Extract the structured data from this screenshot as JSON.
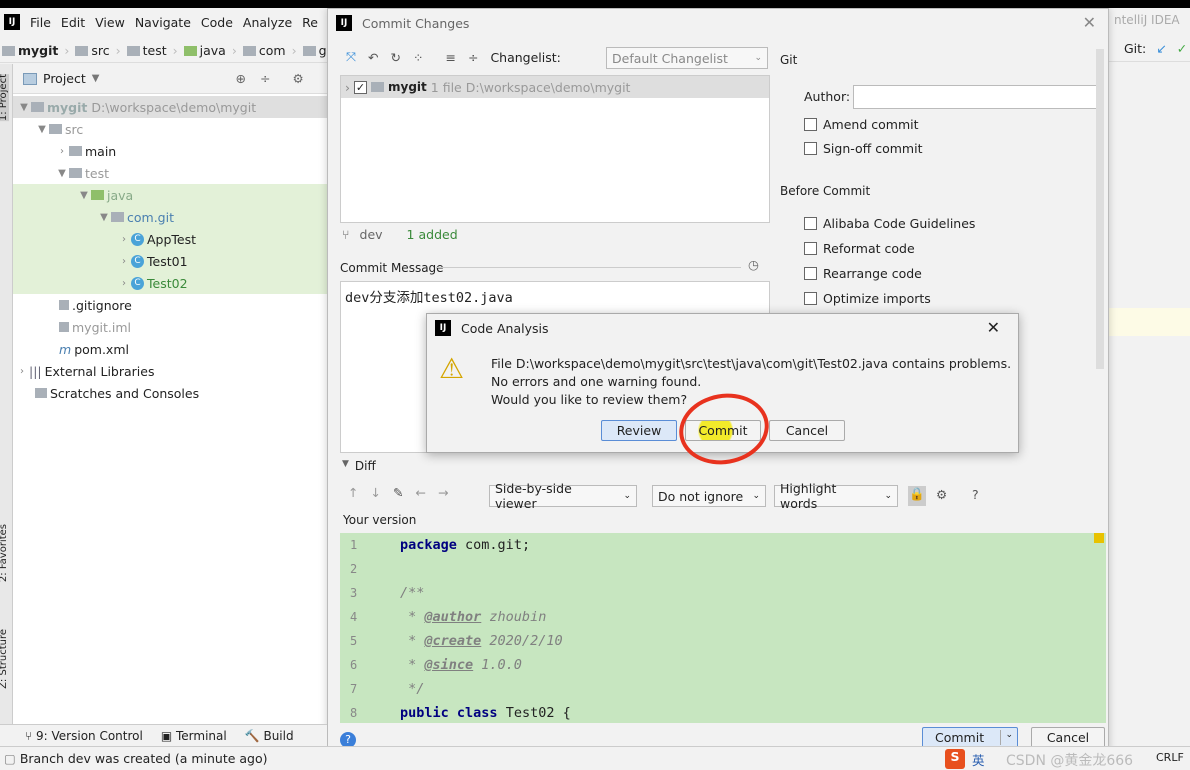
{
  "ide": {
    "menu": [
      "File",
      "Edit",
      "View",
      "Navigate",
      "Code",
      "Analyze",
      "Re"
    ],
    "breadcrumb": [
      "mygit",
      "src",
      "test",
      "java",
      "com",
      "gi"
    ],
    "project_panel_title": "Project",
    "left_strip": {
      "project": "1: Project",
      "favorites": "2: Favorites",
      "structure": "Z: Structure"
    },
    "tree": [
      {
        "label": "mygit",
        "path": "D:\\workspace\\demo\\mygit"
      },
      {
        "label": "src"
      },
      {
        "label": "main"
      },
      {
        "label": "test"
      },
      {
        "label": "java"
      },
      {
        "label": "com.git"
      },
      {
        "label": "AppTest"
      },
      {
        "label": "Test01"
      },
      {
        "label": "Test02"
      },
      {
        "label": ".gitignore"
      },
      {
        "label": "mygit.iml"
      },
      {
        "label": "pom.xml"
      },
      {
        "label": "External Libraries"
      },
      {
        "label": "Scratches and Consoles"
      }
    ],
    "right_title": "ntelliJ IDEA",
    "git_label": "Git:",
    "tool_windows": [
      "9: Version Control",
      "Terminal",
      "Build"
    ],
    "status": "Branch dev was created (a minute ago)",
    "crlf": "CRLF",
    "watermark": "CSDN @黄金龙666",
    "ime": "英"
  },
  "dialog": {
    "title": "Commit Changes",
    "changelist_label": "Changelist:",
    "changelist_value": "Default Changelist",
    "changes_row": {
      "name": "mygit",
      "count": "1 file",
      "path": "D:\\workspace\\demo\\mygit"
    },
    "branch": "dev",
    "added": "1 added",
    "commit_message_label": "Commit Message",
    "commit_message": "dev分支添加test02.java",
    "git_section": "Git",
    "author_label": "Author:",
    "author_value": "",
    "amend": "Amend commit",
    "signoff": "Sign-off commit",
    "before_commit": "Before Commit",
    "checks": [
      "Alibaba Code Guidelines",
      "Reformat code",
      "Rearrange code",
      "Optimize imports"
    ],
    "diff_label": "Diff",
    "viewer": "Side-by-side viewer",
    "ignore": "Do not ignore",
    "highlight": "Highlight words",
    "your_version": "Your version",
    "code": [
      {
        "n": "1",
        "parts": [
          [
            "kw",
            "package"
          ],
          [
            "",
            "com.git;"
          ]
        ]
      },
      {
        "n": "2",
        "parts": []
      },
      {
        "n": "3",
        "parts": [
          [
            "doc",
            "/**"
          ]
        ]
      },
      {
        "n": "4",
        "parts": [
          [
            "doc",
            " * "
          ],
          [
            "tag",
            "@author"
          ],
          [
            "doc",
            " zhoubin"
          ]
        ]
      },
      {
        "n": "5",
        "parts": [
          [
            "doc",
            " * "
          ],
          [
            "tag",
            "@create"
          ],
          [
            "doc",
            " 2020/2/10"
          ]
        ]
      },
      {
        "n": "6",
        "parts": [
          [
            "doc",
            " * "
          ],
          [
            "tag",
            "@since"
          ],
          [
            "doc",
            " 1.0.0"
          ]
        ]
      },
      {
        "n": "7",
        "parts": [
          [
            "doc",
            " */"
          ]
        ]
      },
      {
        "n": "8",
        "parts": [
          [
            "kw",
            "public class"
          ],
          [
            "",
            "Test02 {"
          ]
        ]
      }
    ],
    "commit_button": "Commit",
    "cancel_button": "Cancel",
    "help": "?"
  },
  "popup": {
    "title": "Code Analysis",
    "lines": [
      "File D:\\workspace\\demo\\mygit\\src\\test\\java\\com\\git\\Test02.java contains problems.",
      "No errors and one warning found.",
      "Would you like to review them?"
    ],
    "review": "Review",
    "commit": "Commit",
    "cancel": "Cancel"
  }
}
